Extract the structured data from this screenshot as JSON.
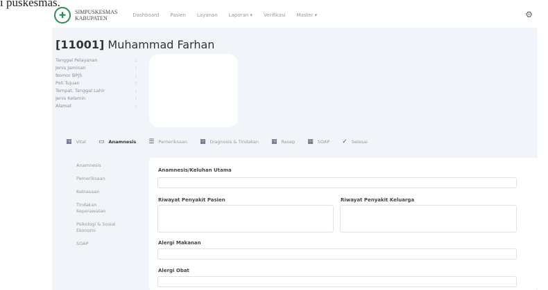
{
  "caption": "i puskesmas.",
  "header": {
    "brand_line1": "SIMPUSKESMAS",
    "brand_line2": "KABUPATEN",
    "nav": [
      "Dashboard",
      "Pasien",
      "Layanan",
      "Laporan ▾",
      "Verifikasi",
      "Master ▾"
    ]
  },
  "patient": {
    "id": "[11001]",
    "name": "Muhammad Farhan",
    "fields": [
      "Tanggal Pelayanan",
      "Jenis Jaminan",
      "Nomor BPJS",
      "Poli Tujuan",
      "Tempat, Tanggal Lahir",
      "Jenis Kelamin",
      "Alamat"
    ],
    "colons": [
      ":",
      ":",
      ":",
      ":",
      ":",
      ":",
      ":"
    ]
  },
  "tabs": [
    {
      "icon": "▦",
      "label": "Vital"
    },
    {
      "icon": "▭",
      "label": "Anamnesis"
    },
    {
      "icon": "☰",
      "label": "Pemeriksaan"
    },
    {
      "icon": "▦",
      "label": "Diagnosis & Tindakan"
    },
    {
      "icon": "▦",
      "label": "Resep"
    },
    {
      "icon": "▦",
      "label": "SOAP"
    },
    {
      "icon": "✓",
      "label": "Selesai"
    }
  ],
  "sidebar": [
    "Anamnesis",
    "Pemeriksaan",
    "Kebiasaan",
    "Tindakan Keperawatan",
    "Psikologi & Sosial Ekonomi",
    "SOAP"
  ],
  "form": {
    "keluhan_utama": "Anamnesis/Keluhan Utama",
    "riwayat_pasien": "Riwayat Penyakit Pasien",
    "riwayat_keluarga": "Riwayat Penyakit Keluarga",
    "alergi_makanan": "Alergi Makanan",
    "alergi_obat": "Alergi Obat"
  }
}
